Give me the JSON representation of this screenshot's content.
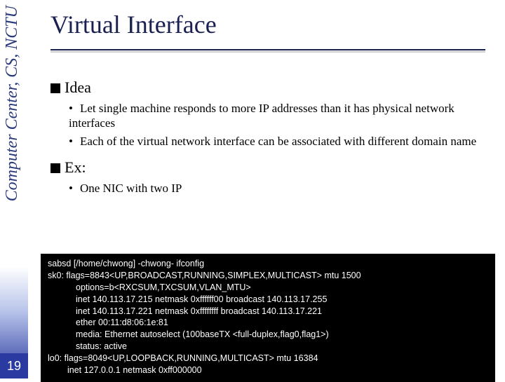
{
  "sidebar_label": "Computer Center, CS, NCTU",
  "page_number": "19",
  "title": "Virtual Interface",
  "sections": [
    {
      "heading": "Idea",
      "bullets": [
        "Let single machine responds to more IP addresses than it has physical network interfaces",
        "Each of the virtual network interface can be associated with different domain name"
      ]
    },
    {
      "heading": "Ex:",
      "bullets": [
        "One NIC with two IP"
      ]
    }
  ],
  "terminal": {
    "line1": "sabsd [/home/chwong] -chwong- ifconfig",
    "line2": "sk0: flags=8843<UP,BROADCAST,RUNNING,SIMPLEX,MULTICAST> mtu 1500",
    "line3": "options=b<RXCSUM,TXCSUM,VLAN_MTU>",
    "line4": "inet 140.113.17.215 netmask 0xffffff00 broadcast 140.113.17.255",
    "line5": "inet 140.113.17.221 netmask 0xffffffff broadcast 140.113.17.221",
    "line6": "ether 00:11:d8:06:1e:81",
    "line7": "media: Ethernet autoselect (100baseTX <full-duplex,flag0,flag1>)",
    "line8": "status: active",
    "line9": "lo0: flags=8049<UP,LOOPBACK,RUNNING,MULTICAST> mtu 16384",
    "line10": "inet 127.0.0.1 netmask 0xff000000"
  }
}
